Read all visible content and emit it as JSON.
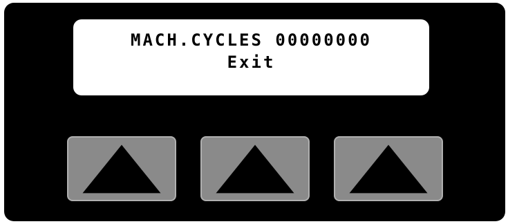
{
  "display": {
    "line1": "MACH.CYCLES 00000000",
    "line2": "Exit"
  },
  "buttons": [
    {
      "icon": "up-triangle-icon"
    },
    {
      "icon": "up-triangle-icon"
    },
    {
      "icon": "up-triangle-icon"
    }
  ],
  "colors": {
    "panel": "#000000",
    "screen": "#ffffff",
    "button": "#8a8a8a",
    "button_border": "#b0b0b0",
    "icon": "#000000"
  }
}
